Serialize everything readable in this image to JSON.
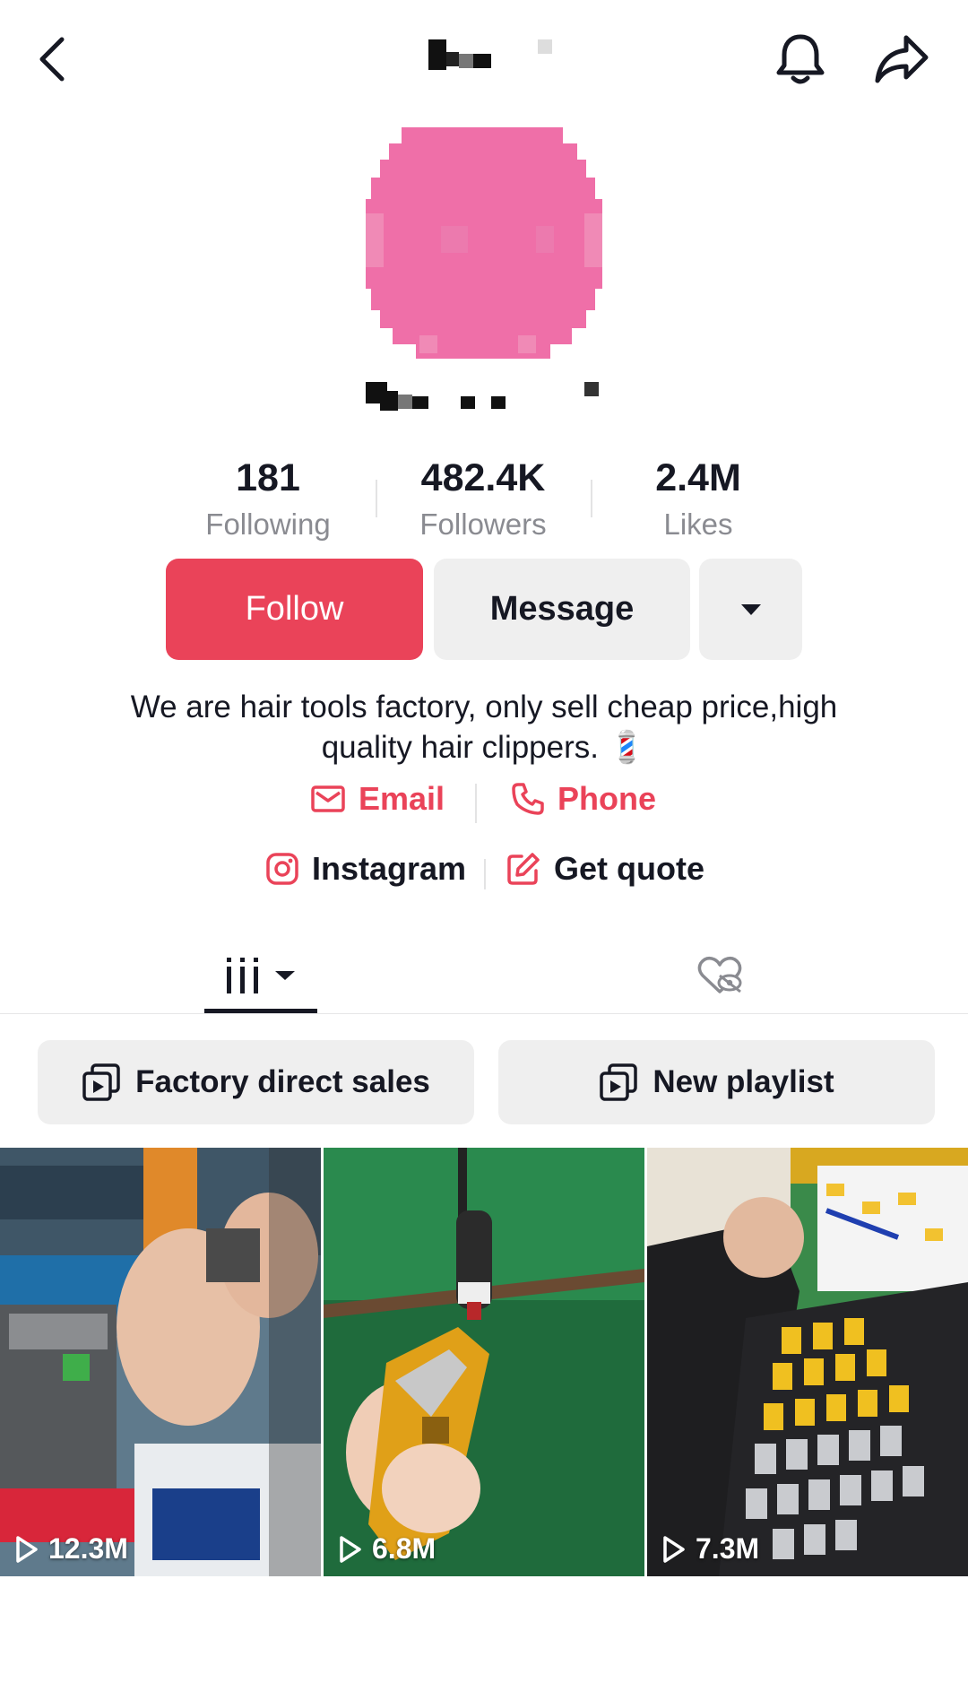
{
  "header": {
    "back_icon": "chevron-left-icon",
    "bell_icon": "bell-icon",
    "share_icon": "share-arrow-icon"
  },
  "profile": {
    "avatar_color": "#ef6fa8"
  },
  "stats": [
    {
      "value": "181",
      "label": "Following"
    },
    {
      "value": "482.4K",
      "label": "Followers"
    },
    {
      "value": "2.4M",
      "label": "Likes"
    }
  ],
  "actions": {
    "follow_label": "Follow",
    "message_label": "Message",
    "more_icon": "caret-down-icon"
  },
  "bio": {
    "line1": "We are hair tools factory, only sell cheap price,high",
    "line2": "quality hair clippers. 💈"
  },
  "contacts": {
    "email_label": "Email",
    "phone_label": "Phone",
    "instagram_label": "Instagram",
    "quote_label": "Get quote"
  },
  "tabs": {
    "videos_icon": "grid-columns-icon",
    "liked_icon": "heart-hidden-icon"
  },
  "playlists": [
    {
      "label": "Factory direct sales"
    },
    {
      "label": "New playlist"
    }
  ],
  "videos": [
    {
      "views": "12.3M"
    },
    {
      "views": "6.8M"
    },
    {
      "views": "7.3M"
    }
  ],
  "colors": {
    "accent": "#ea4359",
    "text": "#161823",
    "muted": "#8a8b91",
    "button_gray": "#efefef"
  }
}
